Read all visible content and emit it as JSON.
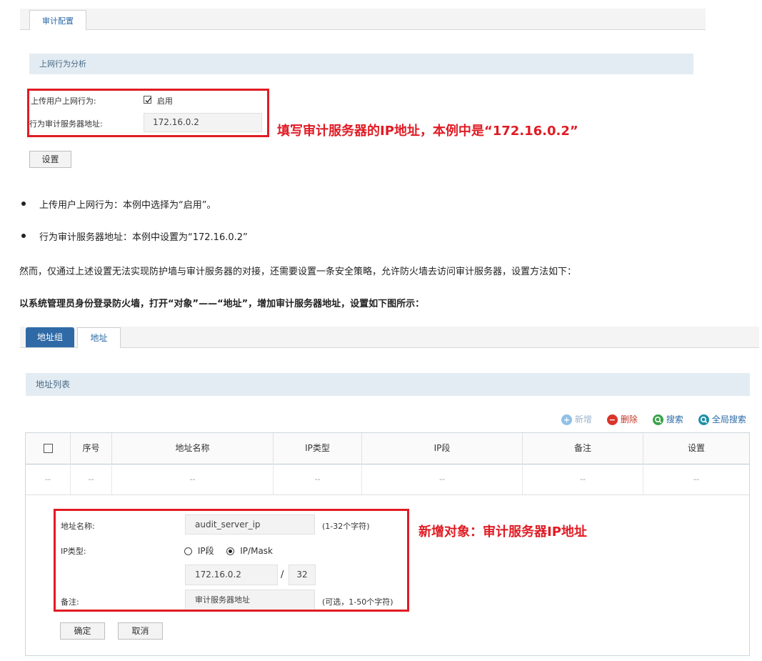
{
  "top_panel": {
    "tab_label": "审计配置",
    "section_title": "上网行为分析",
    "upload_label": "上传用户上网行为:",
    "enable_label": "启用",
    "enable_checked": true,
    "server_label": "行为审计服务器地址:",
    "server_value": "172.16.0.2",
    "annotation": "填写审计服务器的IP地址，本例中是“172.16.0.2”",
    "set_button": "设置"
  },
  "doc": {
    "bullet1": "上传用户上网行为：本例中选择为“启用”。",
    "bullet2": "行为审计服务器地址：本例中设置为“172.16.0.2”",
    "paragraph": "然而，仅通过上述设置无法实现防护墙与审计服务器的对接，还需要设置一条安全策略，允许防火墙去访问审计服务器，设置方法如下：",
    "bold_paragraph": "以系统管理员身份登录防火墙，打开“对象”——“地址”，增加审计服务器地址，设置如下图所示："
  },
  "bottom_panel": {
    "tabs": [
      "地址组",
      "地址"
    ],
    "section_title": "地址列表",
    "toolbar": {
      "add": "新增",
      "delete": "删除",
      "search": "搜索",
      "global_search": "全局搜索"
    },
    "columns": [
      "序号",
      "地址名称",
      "IP类型",
      "IP段",
      "备注",
      "设置"
    ],
    "empty_row": [
      "--",
      "--",
      "--",
      "--",
      "--",
      "--",
      "--"
    ],
    "form": {
      "name_label": "地址名称:",
      "name_value": "audit_server_ip",
      "name_hint": "(1-32个字符)",
      "iptype_label": "IP类型:",
      "opt_range": "IP段",
      "opt_mask": "IP/Mask",
      "selected": "IP/Mask",
      "ip_value": "172.16.0.2",
      "slash": "/",
      "mask_value": "32",
      "note_label": "备注:",
      "note_value": "审计服务器地址",
      "note_hint": "(可选，1-50个字符)",
      "ok_button": "确定",
      "cancel_button": "取消"
    },
    "annotation": "新增对象：审计服务器IP地址"
  },
  "colors": {
    "annotation_red": "#e01b24",
    "tab_blue": "#2f6aa6",
    "section_bg": "#e3ecf3"
  }
}
